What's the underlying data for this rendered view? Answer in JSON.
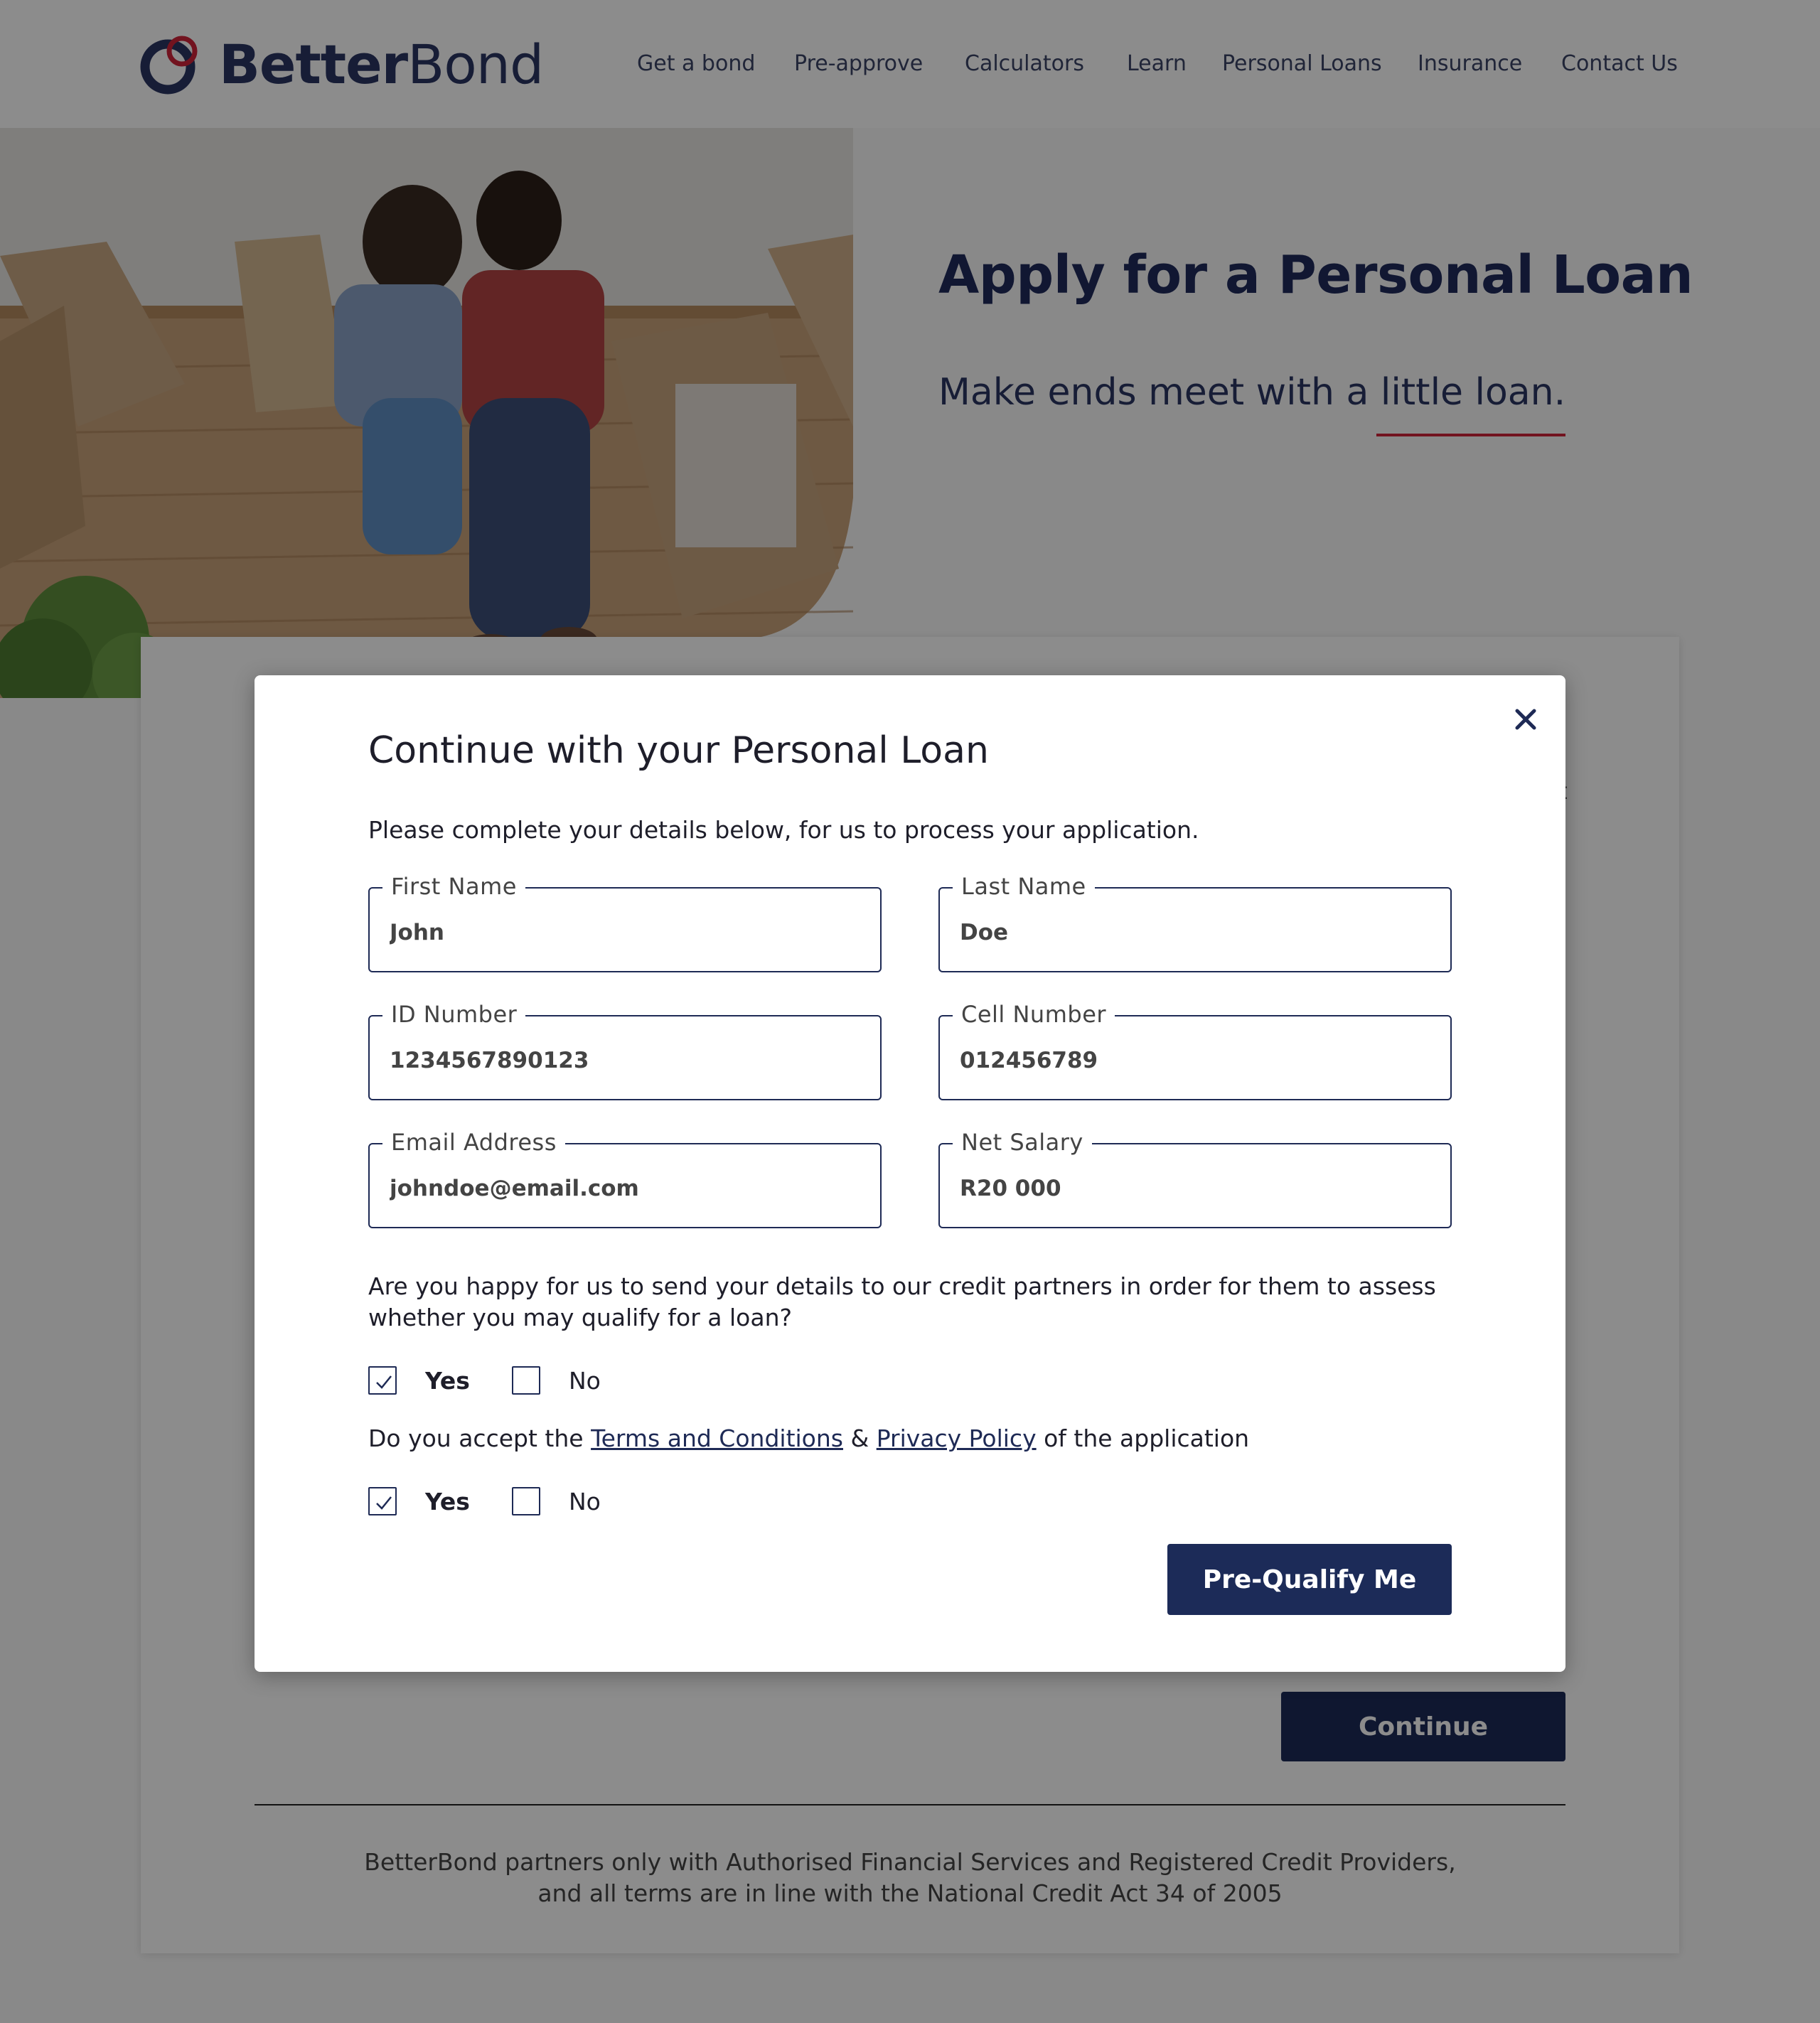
{
  "header": {
    "logo_bold": "Better",
    "logo_regular": "Bond",
    "nav": [
      "Get a bond",
      "Pre-approve",
      "Calculators",
      "Learn",
      "Personal Loans",
      "Insurance",
      "Contact Us"
    ]
  },
  "hero": {
    "title": "Apply for a Personal Loan",
    "subtitle": "Make ends meet with a little loan."
  },
  "background_card": {
    "peek_char": "t",
    "continue_label": "Continue",
    "disclaimer_line1": "BetterBond partners only with Authorised Financial Services and Registered Credit Providers,",
    "disclaimer_line2": "and all terms are in line with the National Credit Act 34 of 2005"
  },
  "modal": {
    "title": "Continue with your Personal Loan",
    "intro": "Please complete your details below, for us to process your application.",
    "fields": {
      "first_name": {
        "label": "First Name",
        "value": "John"
      },
      "last_name": {
        "label": "Last Name",
        "value": "Doe"
      },
      "id_number": {
        "label": "ID Number",
        "value": "1234567890123"
      },
      "cell_number": {
        "label": "Cell Number",
        "value": "012456789"
      },
      "email": {
        "label": "Email Address",
        "value": "johndoe@email.com"
      },
      "net_salary": {
        "label": "Net Salary",
        "value": "R20 000"
      }
    },
    "q1": {
      "text_line1": "Are you happy for us to send your details to our credit partners in order for them to assess",
      "text_line2": "whether you may qualify for a loan?",
      "yes": "Yes",
      "no": "No",
      "selected": "Yes"
    },
    "q2": {
      "prefix": "Do you accept the ",
      "terms_link": "Terms and Conditions",
      "amp": " & ",
      "privacy_link": "Privacy Policy",
      "suffix": " of the application",
      "yes": "Yes",
      "no": "No",
      "selected": "Yes"
    },
    "submit_label": "Pre-Qualify Me"
  },
  "colors": {
    "brand_navy": "#1c2b58",
    "accent_red": "#d0243a"
  }
}
